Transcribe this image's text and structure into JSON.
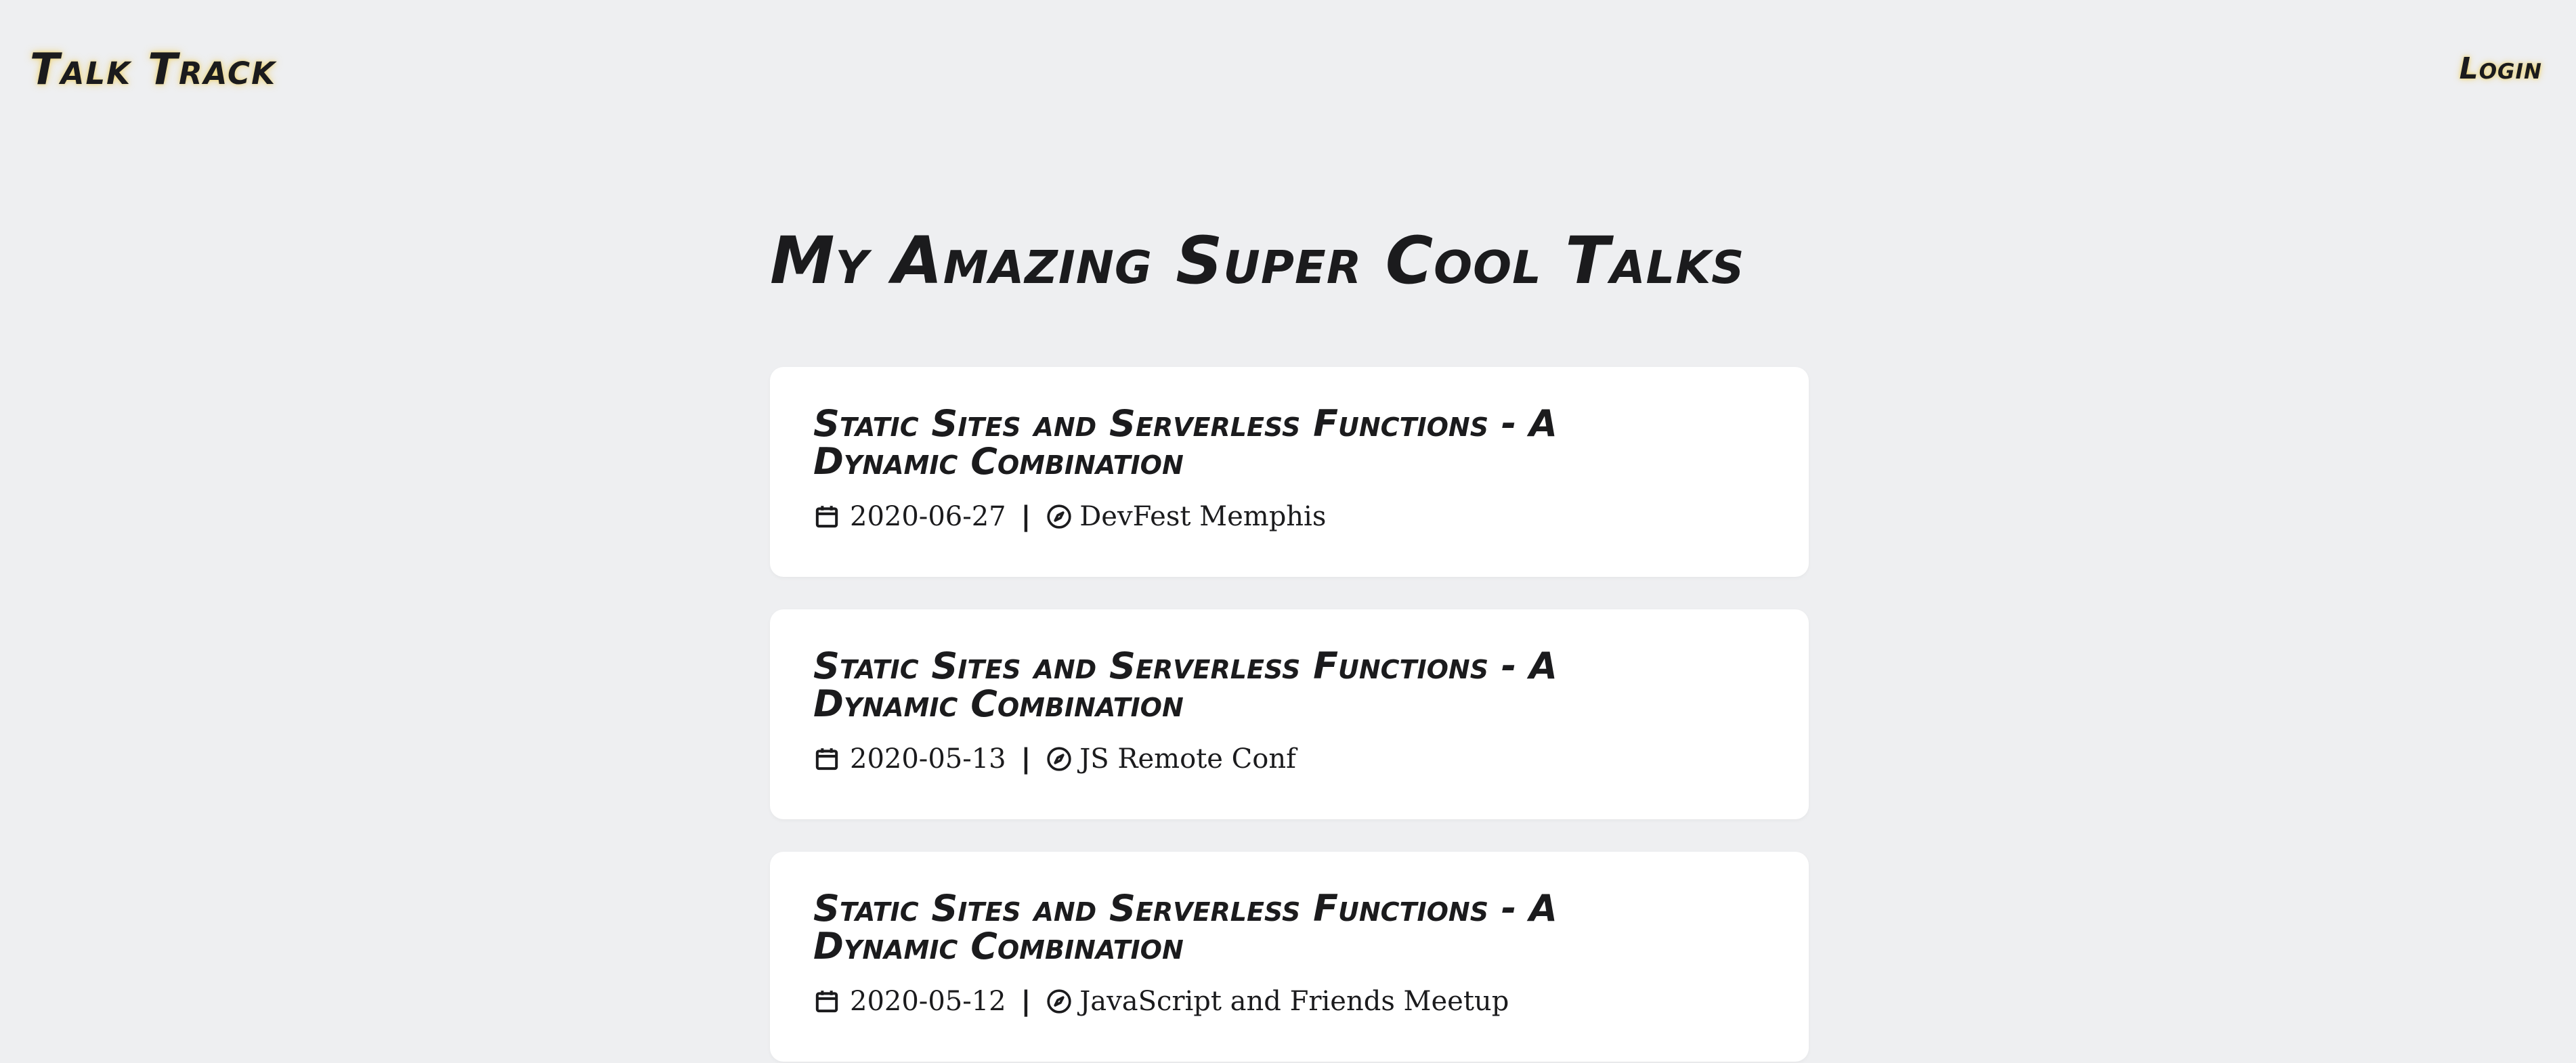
{
  "header": {
    "brand": "Talk Track",
    "login_label": "Login"
  },
  "main": {
    "title": "My Amazing Super Cool Talks",
    "separator": "|",
    "talks": [
      {
        "title": "Static Sites and Serverless Functions - A Dynamic Combination",
        "date": "2020-06-27",
        "event": "DevFest Memphis"
      },
      {
        "title": "Static Sites and Serverless Functions - A Dynamic Combination",
        "date": "2020-05-13",
        "event": "JS Remote Conf"
      },
      {
        "title": "Static Sites and Serverless Functions - A Dynamic Combination",
        "date": "2020-05-12",
        "event": "JavaScript and Friends Meetup"
      }
    ]
  },
  "icons": {
    "date": "calendar-icon",
    "event": "compass-icon"
  },
  "colors": {
    "background": "#eeeff1",
    "card": "#ffffff",
    "text": "#1b1b1d",
    "glow": "#eecc50"
  }
}
